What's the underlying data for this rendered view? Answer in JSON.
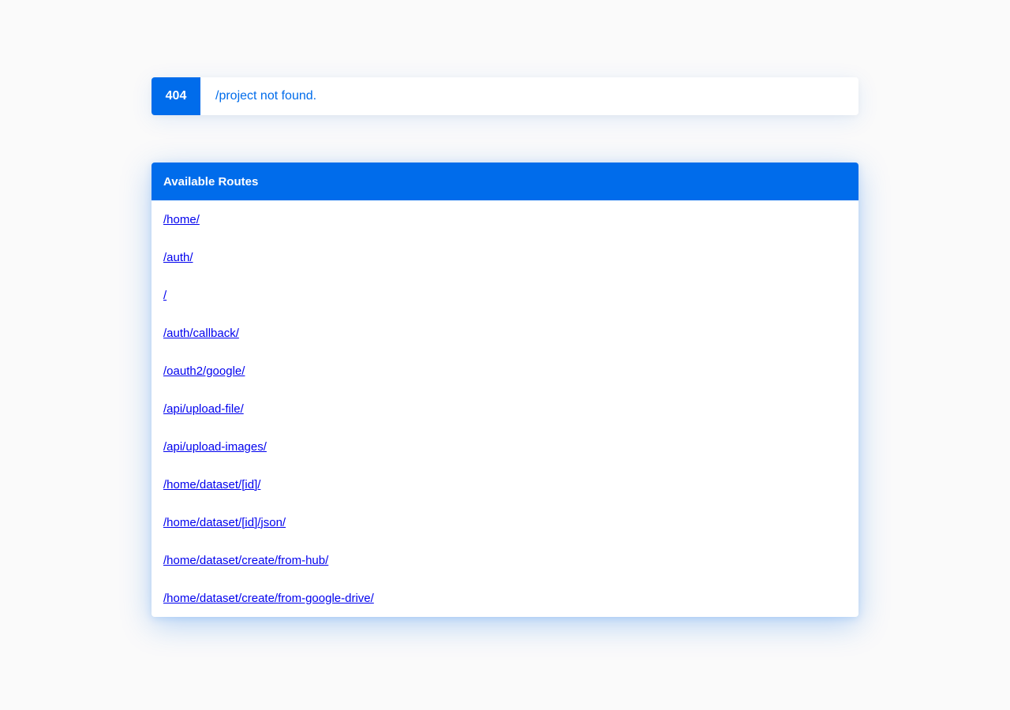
{
  "error": {
    "code": "404",
    "message": "/project not found."
  },
  "routes": {
    "header": "Available Routes",
    "items": [
      "/home/",
      "/auth/",
      "/",
      "/auth/callback/",
      "/oauth2/google/",
      "/api/upload-file/",
      "/api/upload-images/",
      "/home/dataset/[id]/",
      "/home/dataset/[id]/json/",
      "/home/dataset/create/from-hub/",
      "/home/dataset/create/from-google-drive/"
    ]
  },
  "colors": {
    "accent": "#006ceb",
    "link": "#0000ee",
    "background": "#fafafa"
  }
}
